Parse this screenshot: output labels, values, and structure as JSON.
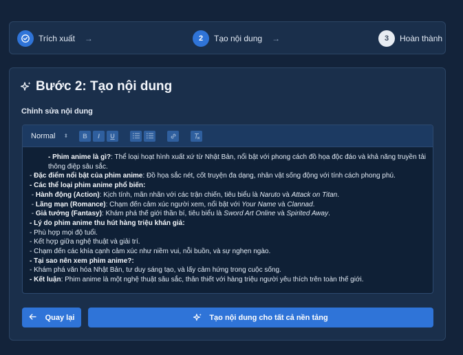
{
  "stepper": {
    "steps": [
      {
        "number": "",
        "label": "Trích xuất",
        "state": "done",
        "icon": "check-circle-icon"
      },
      {
        "number": "2",
        "label": "Tạo nội dung",
        "state": "active"
      },
      {
        "number": "3",
        "label": "Hoàn thành",
        "state": "pending"
      }
    ],
    "arrow_glyph": "→"
  },
  "card": {
    "title": "Bước 2: Tạo nội dung",
    "title_icon": "sparkles-icon",
    "section_label": "Chỉnh sửa nội dung"
  },
  "editor": {
    "format_select": "Normal",
    "toolbar_buttons": [
      "B",
      "I",
      "U"
    ],
    "content": {
      "l1a": "- Phim anime là gì?",
      "l1b": ": Thể loại hoạt hình xuất xứ từ Nhật Bản, nổi bật với phong cách đồ họa độc đáo và khả năng truyền tải thông điệp sâu sắc.",
      "l2a": "Đặc điểm nổi bật của phim anime",
      "l2b": ": Đồ họa sắc nét, cốt truyện đa dạng, nhân vật sống động với tính cách phong phú.",
      "l3": "Các thể loại phim anime phổ biến:",
      "l4a": "Hành động (Action)",
      "l4b": ": Kịch tính, mãn nhãn với các trận chiến, tiêu biểu là ",
      "l4c": "Naruto",
      "l4d": " và ",
      "l4e": "Attack on Titan",
      "l5a": "Lãng mạn (Romance)",
      "l5b": ": Chạm đến cảm xúc người xem, nổi bật với ",
      "l5c": "Your Name",
      "l5d": " và ",
      "l5e": "Clannad",
      "l6a": "Giả tưởng (Fantasy)",
      "l6b": ": Khám phá thế giới thần bí, tiêu biểu là ",
      "l6c": "Sword Art Online",
      "l6d": " và ",
      "l6e": "Spirited Away",
      "l7": "Lý do phim anime thu hút hàng triệu khán giả:",
      "l8": "- Phù hợp mọi độ tuổi.",
      "l9": "- Kết hợp giữa nghệ thuật và giải trí.",
      "l10": "- Chạm đến các khía cạnh cảm xúc như niềm vui, nỗi buồn, và sự nghẹn ngào.",
      "l11": "Tại sao nên xem phim anime?:",
      "l12": "- Khám phá văn hóa Nhật Bản, tư duy sáng tạo, và lấy cảm hứng trong cuộc sống.",
      "l13a": "Kết luận",
      "l13b": ": Phim anime là một nghệ thuật sâu sắc, thân thiết với hàng triệu người yêu thích trên toàn thế giới."
    }
  },
  "actions": {
    "back_label": "Quay lại",
    "generate_label": "Tạo nội dung cho tất cả nền tảng"
  },
  "colors": {
    "background": "#13233a",
    "panel": "#1a2f4b",
    "accent": "#2f74d8",
    "toolbar": "#1c3a62"
  }
}
